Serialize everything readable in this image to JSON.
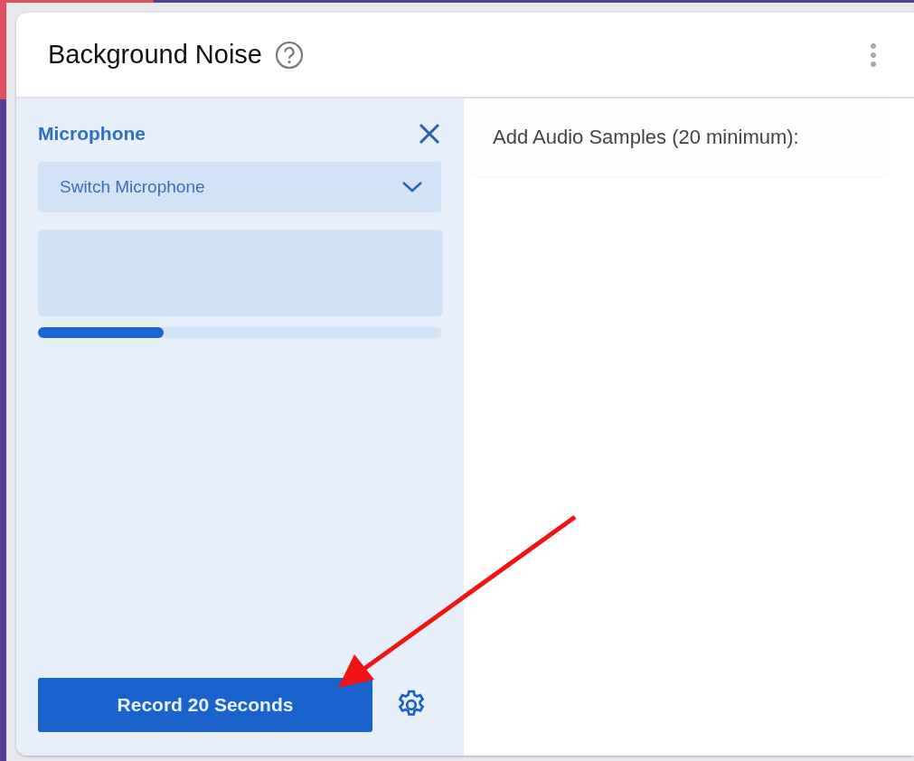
{
  "card": {
    "title": "Background Noise"
  },
  "microphone_panel": {
    "label": "Microphone",
    "dropdown": {
      "value": "Switch Microphone"
    },
    "level": 0.31,
    "record_button": "Record 20 Seconds"
  },
  "samples_panel": {
    "title": "Add Audio Samples (20 minimum):"
  }
}
